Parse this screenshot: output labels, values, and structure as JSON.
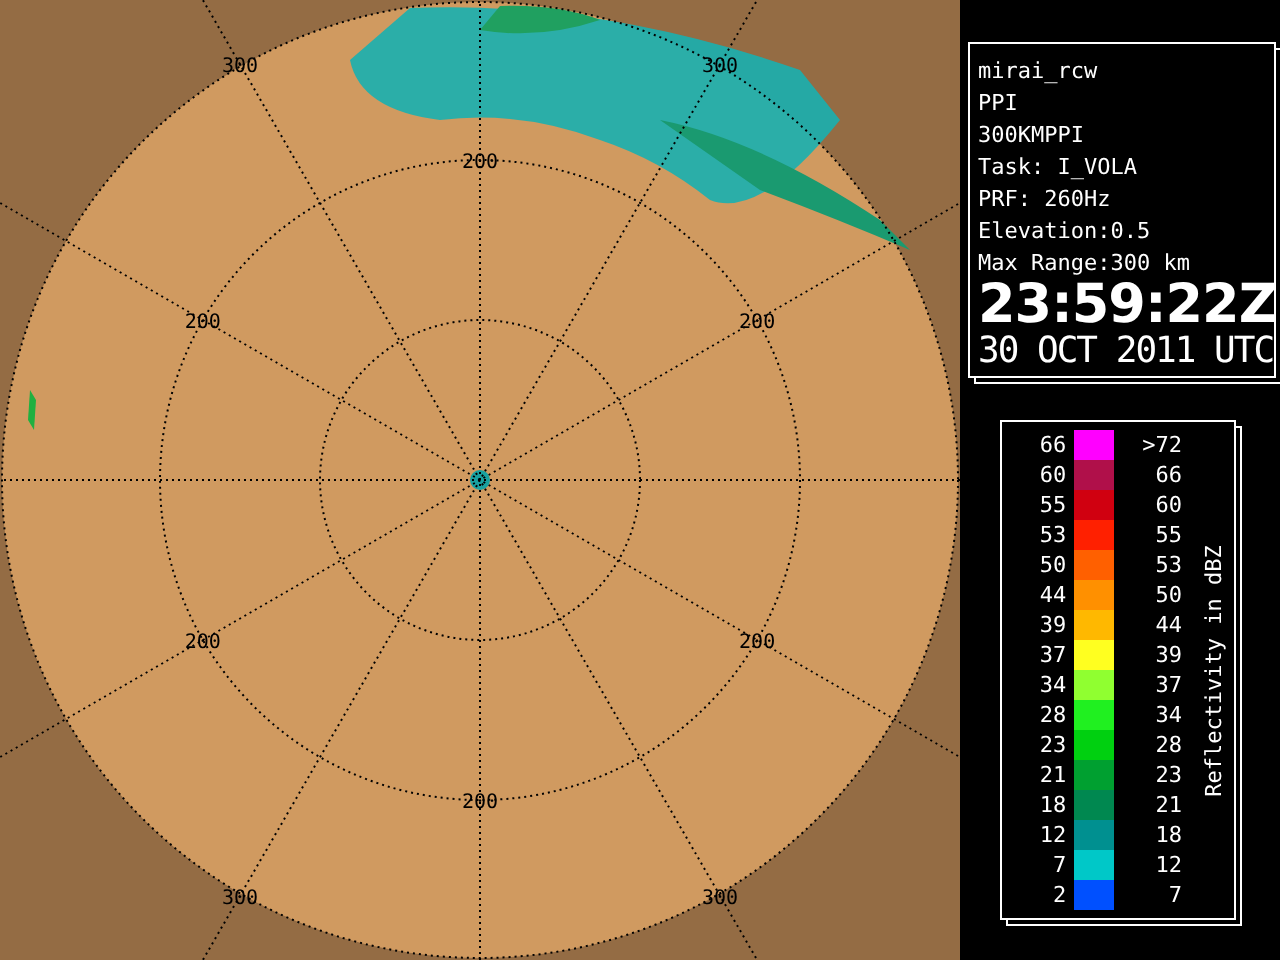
{
  "radar": {
    "range_labels": [
      "300",
      "300",
      "200",
      "200",
      "200",
      "200",
      "200",
      "200",
      "300",
      "300"
    ]
  },
  "info": {
    "lines": [
      "mirai_rcw",
      "PPI",
      "300KMPPI",
      "Task: I_VOLA",
      "PRF: 260Hz",
      "Elevation:0.5",
      "Max Range:300 km"
    ],
    "time": "23:59:22Z",
    "date": "30 OCT 2011 UTC"
  },
  "legend": {
    "title": "Reflectivity in dBZ",
    "rows": [
      {
        "low": "66",
        "high": ">72",
        "color": "#ff00ff"
      },
      {
        "low": "60",
        "high": "66",
        "color": "#b0104a"
      },
      {
        "low": "55",
        "high": "60",
        "color": "#d00010"
      },
      {
        "low": "53",
        "high": "55",
        "color": "#ff2000"
      },
      {
        "low": "50",
        "high": "53",
        "color": "#ff6000"
      },
      {
        "low": "44",
        "high": "50",
        "color": "#ff9000"
      },
      {
        "low": "39",
        "high": "44",
        "color": "#ffb800"
      },
      {
        "low": "37",
        "high": "39",
        "color": "#ffff20"
      },
      {
        "low": "34",
        "high": "37",
        "color": "#90ff30"
      },
      {
        "low": "28",
        "high": "34",
        "color": "#20f020"
      },
      {
        "low": "23",
        "high": "28",
        "color": "#00d010"
      },
      {
        "low": "21",
        "high": "23",
        "color": "#00a030"
      },
      {
        "low": "18",
        "high": "21",
        "color": "#008850"
      },
      {
        "low": "12",
        "high": "18",
        "color": "#009090"
      },
      {
        "low": "7",
        "high": "12",
        "color": "#00c8c8"
      },
      {
        "low": "2",
        "high": "7",
        "color": "#0050ff"
      }
    ]
  }
}
